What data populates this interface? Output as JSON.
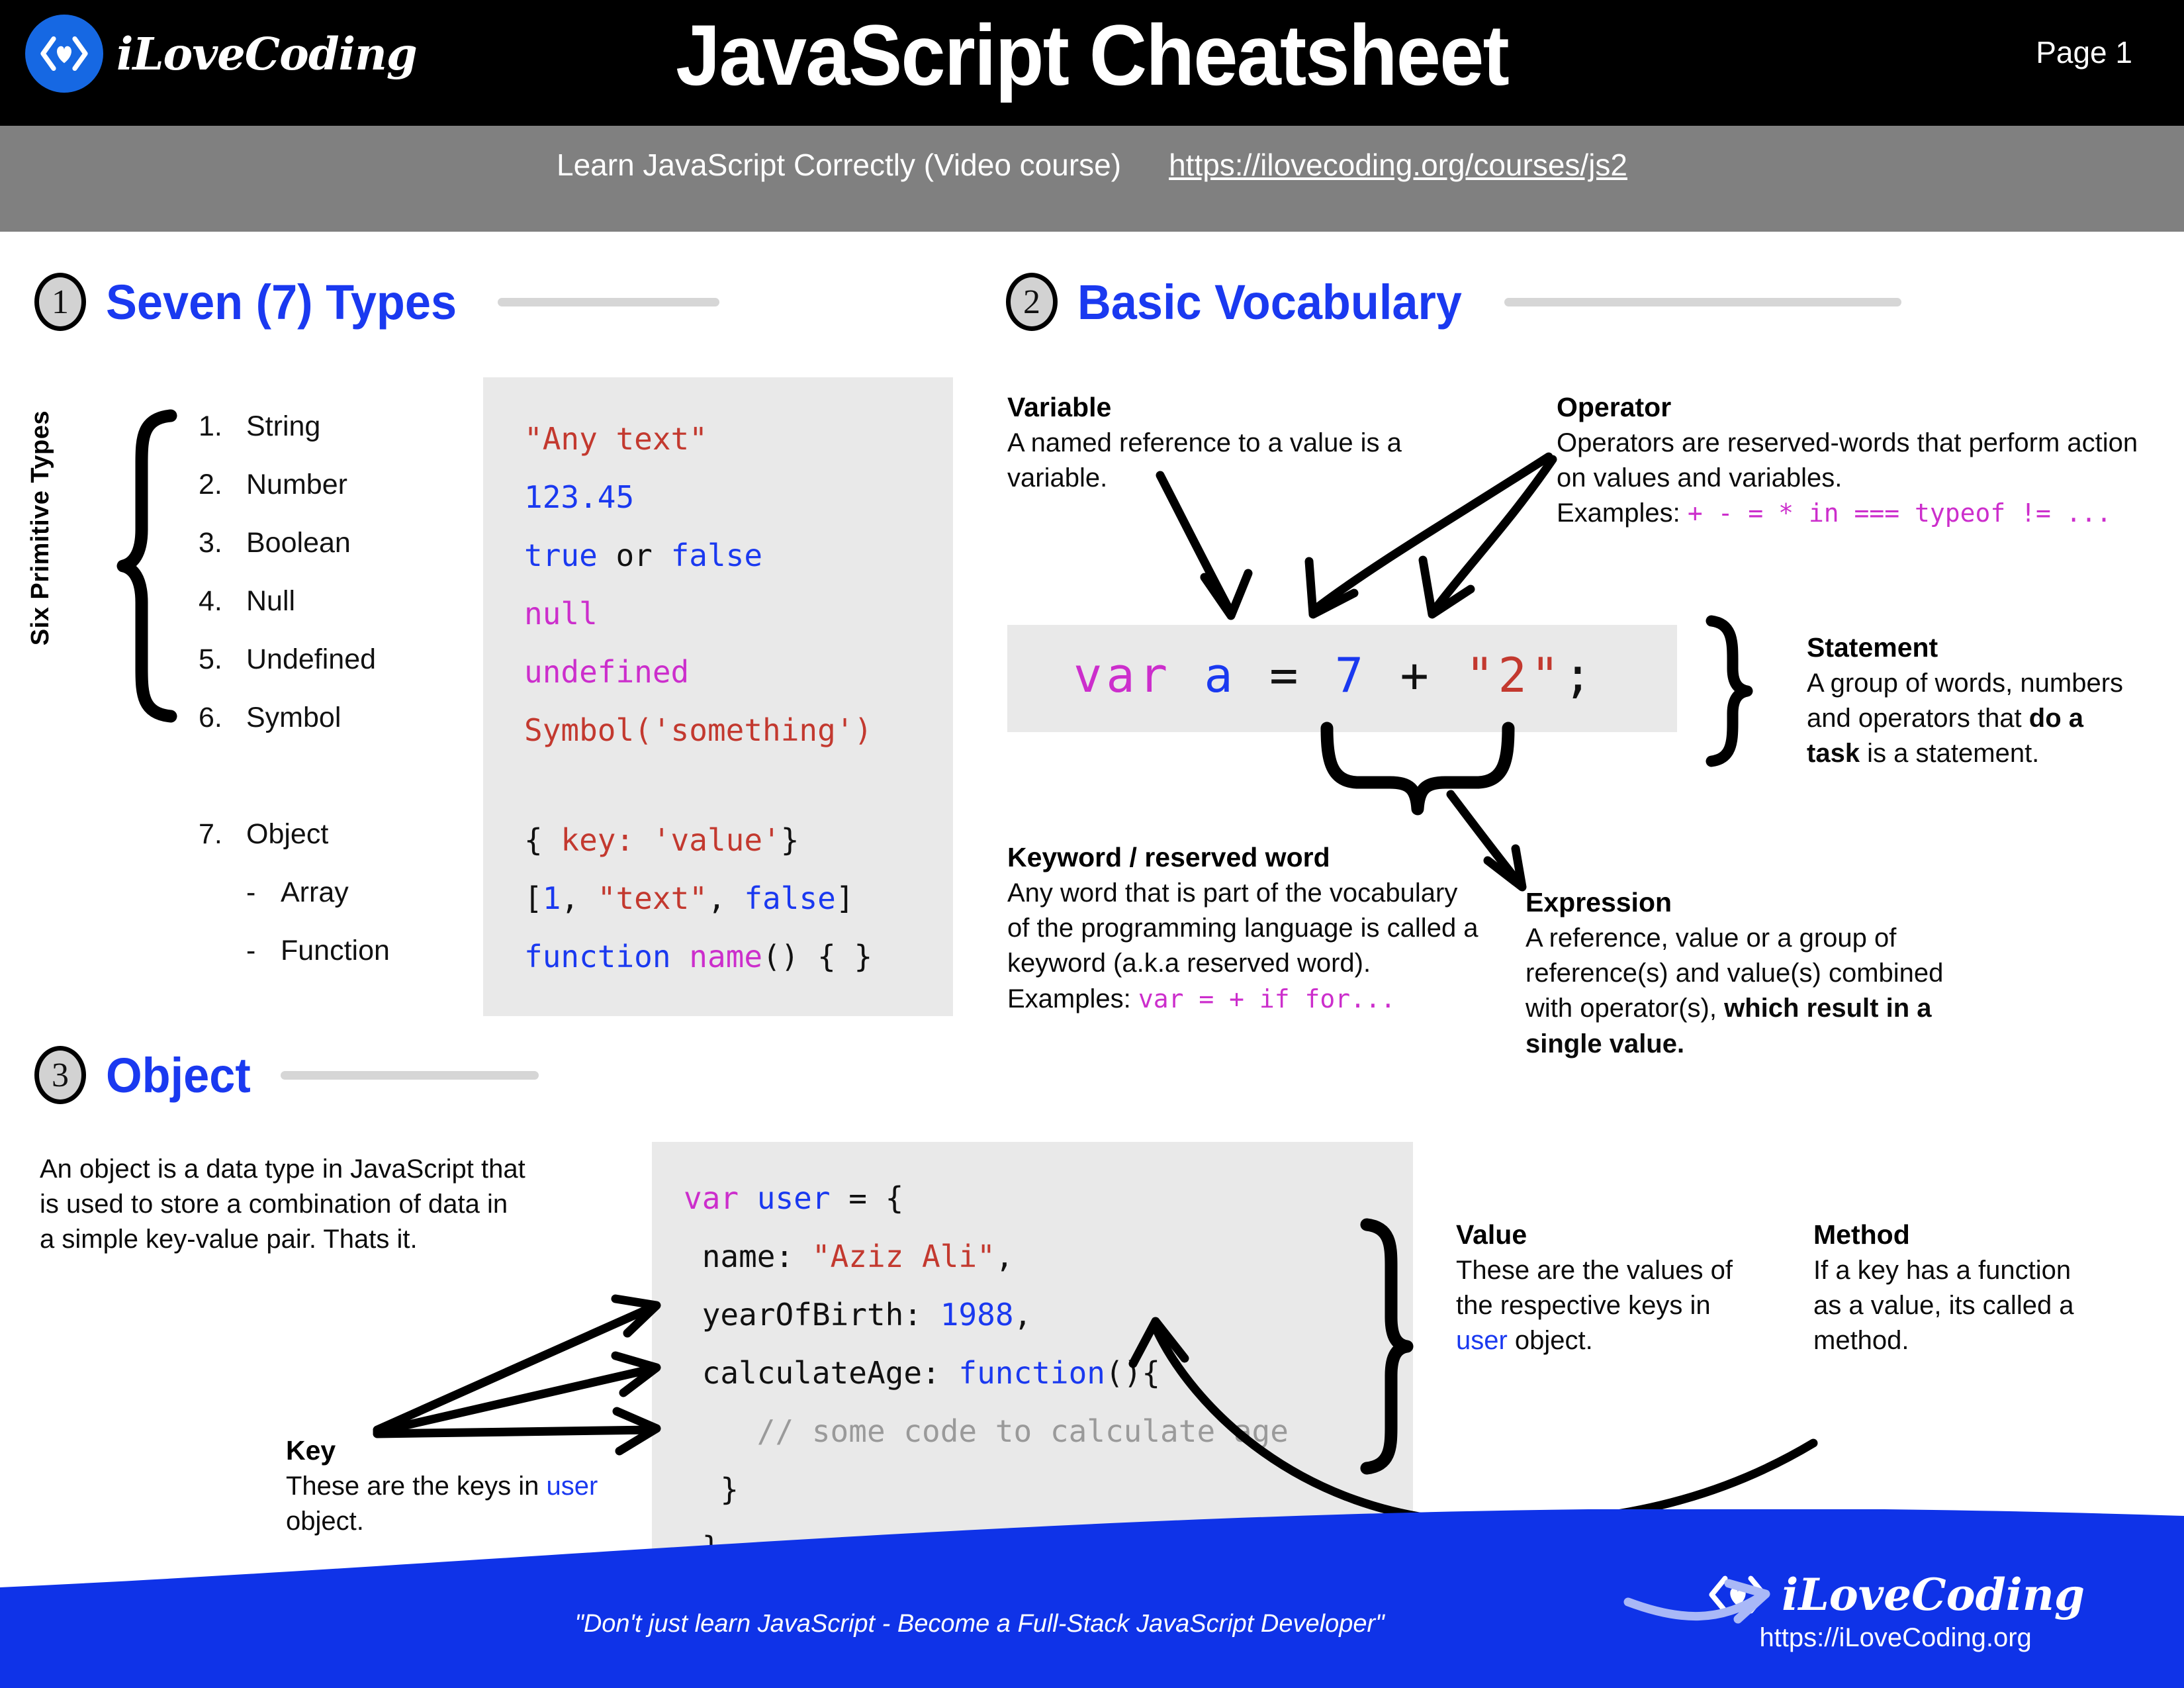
{
  "header": {
    "brand": "iLoveCoding",
    "brand_icon": "code-heart-logo",
    "title": "JavaScript Cheatsheet",
    "page_label": "Page 1",
    "subtitle": "Learn JavaScript Correctly (Video course)",
    "course_url": "https://ilovecoding.org/courses/js2"
  },
  "colors": {
    "accent_blue": "#1a39f0",
    "brand_blue": "#1668e3",
    "footer_blue": "#0f33e8",
    "header_black": "#000000",
    "header_grey": "#808080",
    "code_bg": "#e9e9e9",
    "string_red": "#c3392f",
    "keyword_magenta": "#cc2ecc",
    "comment_grey": "#9a9a9a"
  },
  "section1": {
    "number": "1",
    "title": "Seven (7) Types",
    "vertical_label": "Six Primitive Types",
    "items": [
      {
        "n": "1.",
        "label": "String"
      },
      {
        "n": "2.",
        "label": "Number"
      },
      {
        "n": "3.",
        "label": "Boolean"
      },
      {
        "n": "4.",
        "label": "Null"
      },
      {
        "n": "5.",
        "label": "Undefined"
      },
      {
        "n": "6.",
        "label": "Symbol"
      }
    ],
    "object_item": {
      "n": "7.",
      "label": "Object"
    },
    "object_subitems": [
      {
        "d": "-",
        "label": "Array"
      },
      {
        "d": "-",
        "label": "Function"
      }
    ],
    "code": {
      "l1_str": "\"Any text\"",
      "l2_num": "123.45",
      "l3_a": "true",
      "l3_or": " or ",
      "l3_b": "false",
      "l4_null": "null",
      "l5_undefined": "undefined",
      "l6_symbol": "Symbol('something')",
      "l7_brace_open": "{ ",
      "l7_keyvalue": "key: 'value'",
      "l7_brace_close": "}",
      "l8_bracket_open": "[",
      "l8_one": "1",
      "l8_comma1": ", ",
      "l8_text": "\"text\"",
      "l8_comma2": ", ",
      "l8_false": "false",
      "l8_bracket_close": "]",
      "l9_function": "function ",
      "l9_name": "name",
      "l9_rest": "() { }"
    }
  },
  "section2": {
    "number": "2",
    "title": "Basic Vocabulary",
    "variable": {
      "heading": "Variable",
      "body": "A named reference to a value is a variable."
    },
    "operator": {
      "heading": "Operator",
      "body": "Operators are reserved-words that perform action on values and variables.",
      "examples_prefix": "Examples: ",
      "examples": "+ - = * in === typeof != ..."
    },
    "statement_code": {
      "kw_var": "var ",
      "ident_a": "a",
      "eq": " = ",
      "num7": "7",
      "plus": " + ",
      "str2": "\"2\"",
      "semi": ";"
    },
    "statement": {
      "heading": "Statement",
      "body_pre": "A group of words, numbers and operators that ",
      "body_bold": "do a task",
      "body_post": " is a statement."
    },
    "keyword": {
      "heading": "Keyword / reserved word",
      "body": "Any word that is part of the vocabulary of the programming language is called a keyword (a.k.a reserved word).",
      "examples_prefix": "Examples: ",
      "examples": "var = + if for..."
    },
    "expression": {
      "heading": "Expression",
      "body_pre": "A reference, value or a group of reference(s) and value(s) combined with operator(s), ",
      "body_bold": "which result in a single value."
    }
  },
  "section3": {
    "number": "3",
    "title": "Object",
    "intro": "An object is a data type in JavaScript that is used to store a combination of data in a simple key-value pair. Thats it.",
    "code": {
      "l1_var": "var ",
      "l1_user": "user",
      "l1_rest": " = {",
      "l2_key": " name: ",
      "l2_val": "\"Aziz Ali\"",
      "l2_comma": ",",
      "l3_key": " yearOfBirth: ",
      "l3_val": "1988",
      "l3_comma": ",",
      "l4_key": " calculateAge: ",
      "l4_fn": "function",
      "l4_rest": "(){",
      "l5_comment": "    // some code to calculate age",
      "l6_close": "  }",
      "l7_close": " }"
    },
    "key": {
      "heading": "Key",
      "body_pre": "These are the keys in ",
      "body_hl": "user",
      "body_post": " object."
    },
    "value": {
      "heading": "Value",
      "body_pre": "These are the values of the respective keys in ",
      "body_hl": "user",
      "body_post": " object."
    },
    "method": {
      "heading": "Method",
      "body": "If a key has a function as a value, its called a method."
    }
  },
  "footer": {
    "quote": "\"Don't just learn JavaScript - Become a Full-Stack JavaScript Developer\"",
    "brand": "iLoveCoding",
    "brand_icon": "code-heart-logo",
    "url": "https://iLoveCoding.org"
  }
}
